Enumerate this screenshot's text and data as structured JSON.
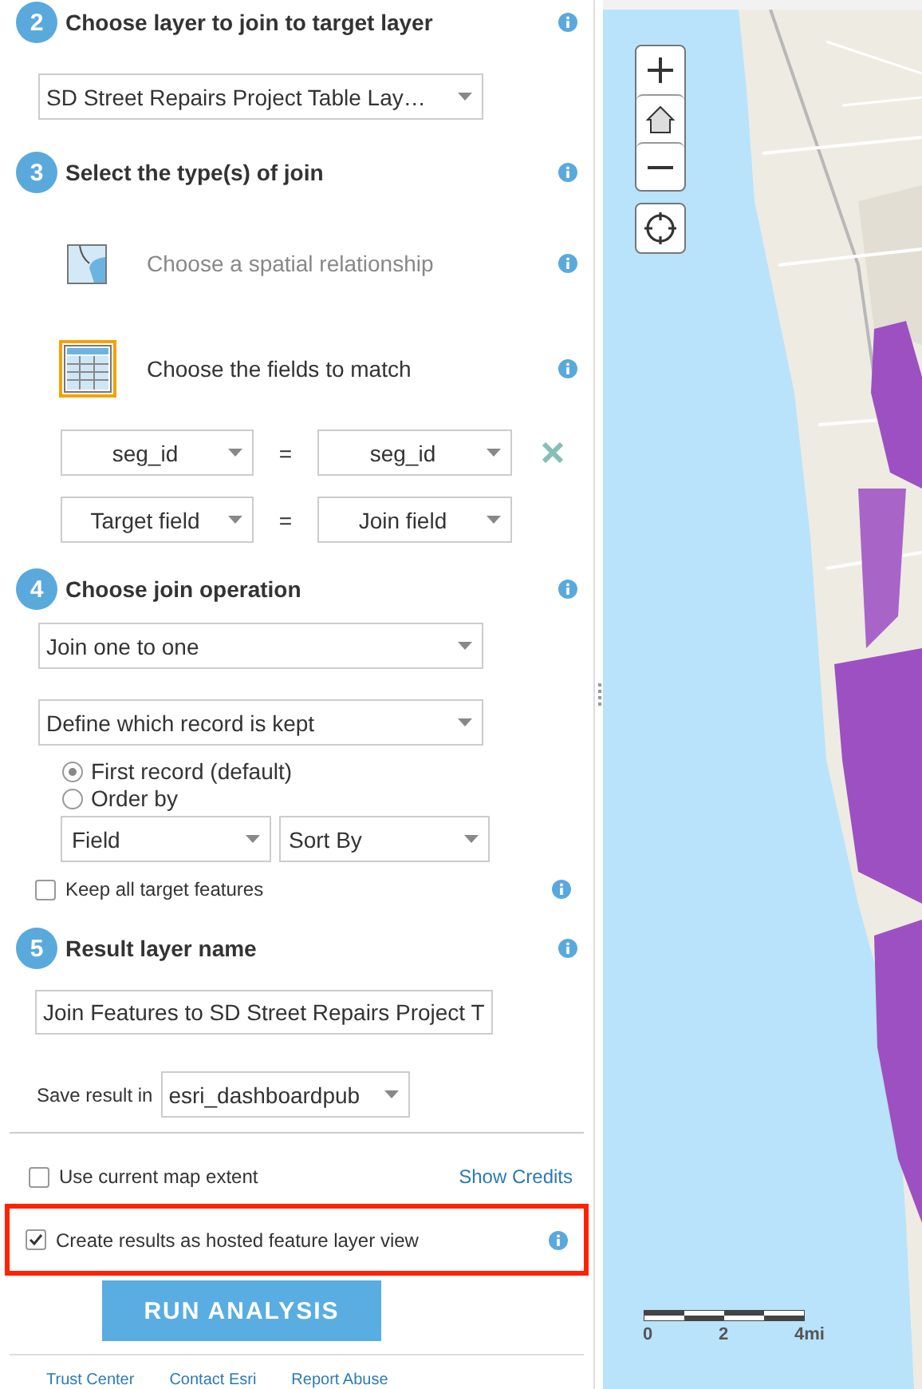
{
  "step2": {
    "number": "2",
    "title": "Choose layer to join to target layer",
    "layer_select": "SD Street Repairs Project Table Lay…"
  },
  "step3": {
    "number": "3",
    "title": "Select the type(s) of join",
    "join_types": [
      {
        "label": "Choose a spatial relationship",
        "kind": "spatial",
        "selected": false
      },
      {
        "label": "Choose the fields to match",
        "kind": "fields",
        "selected": true
      }
    ],
    "field_pairs": [
      {
        "target": "seg_id",
        "operator": "=",
        "join": "seg_id",
        "removable": true
      },
      {
        "target": "Target field",
        "operator": "=",
        "join": "Join field",
        "removable": false
      }
    ]
  },
  "step4": {
    "number": "4",
    "title": "Choose join operation",
    "operation_select": "Join one to one",
    "record_select": "Define which record is kept",
    "record_options": [
      {
        "label": "First record (default)",
        "selected": true
      },
      {
        "label": "Order by",
        "selected": false
      }
    ],
    "order_field_select": "Field",
    "sort_select": "Sort By",
    "keep_all": {
      "label": "Keep all target features",
      "checked": false
    }
  },
  "step5": {
    "number": "5",
    "title": "Result layer name",
    "name_value": "Join Features to SD Street Repairs Project T",
    "save_label": "Save result in",
    "save_select": "esri_dashboardpub"
  },
  "options": [
    {
      "label": "Use current map extent",
      "checked": false,
      "highlighted": false
    },
    {
      "label": "Create results as hosted feature layer view",
      "checked": true,
      "highlighted": true
    }
  ],
  "show_credits": "Show Credits",
  "run_button": "RUN ANALYSIS",
  "footer_links": [
    "Trust Center",
    "Contact Esri",
    "Report Abuse"
  ],
  "map": {
    "scale_labels": [
      "0",
      "2",
      "4mi"
    ]
  }
}
